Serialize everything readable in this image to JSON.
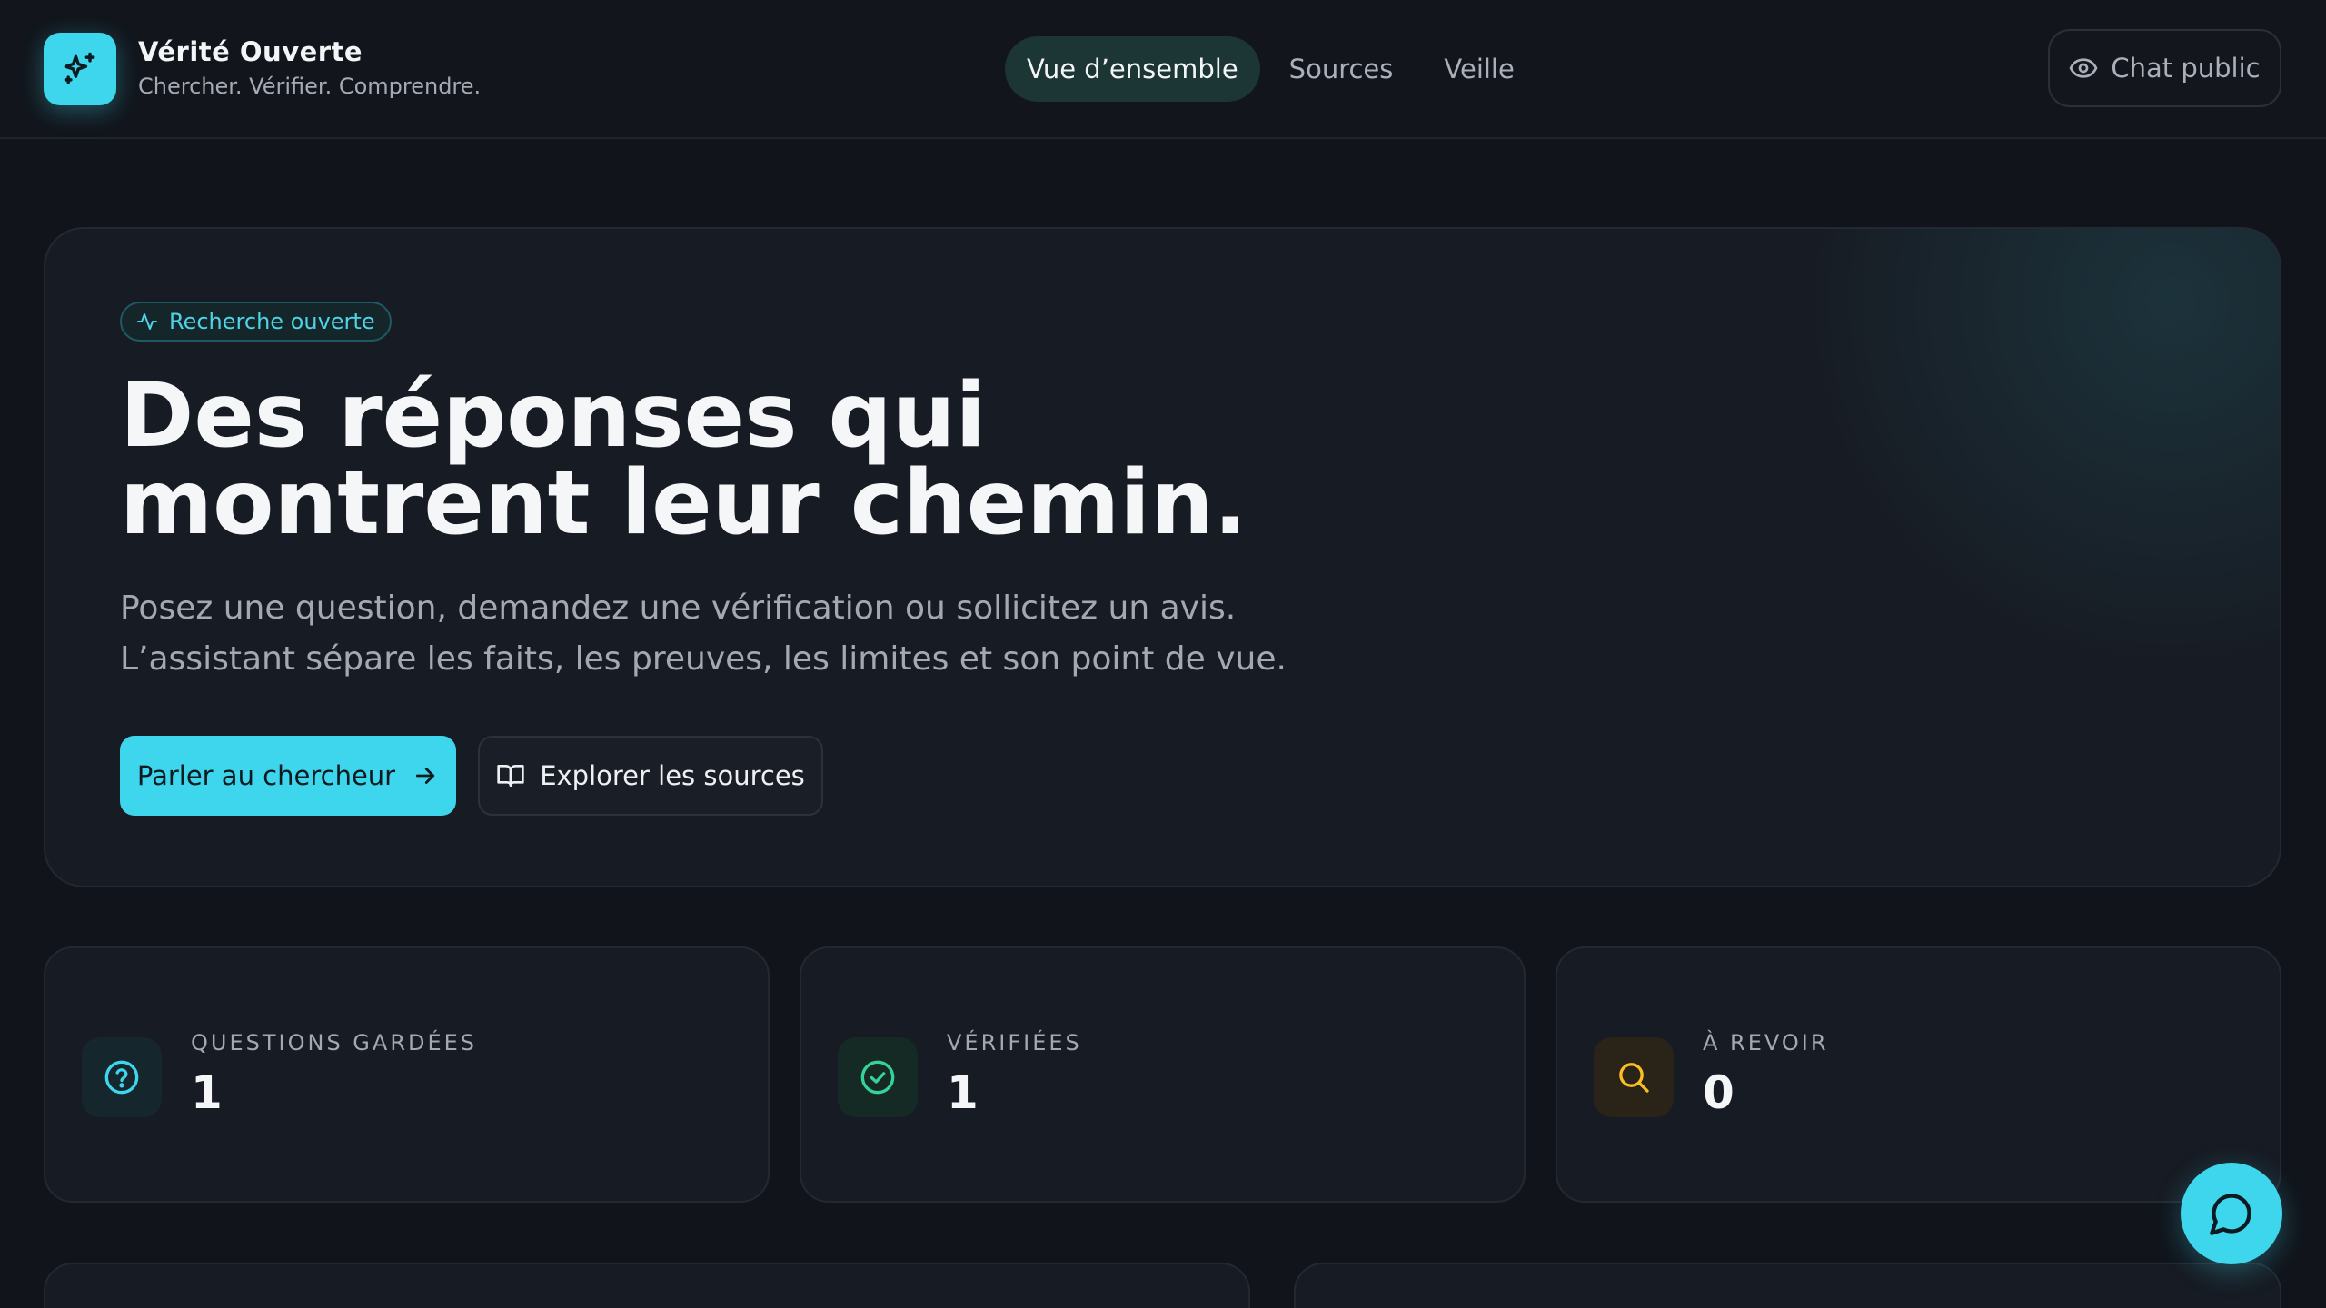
{
  "brand": {
    "title": "Vérité Ouverte",
    "tagline": "Chercher. Vérifier. Comprendre.",
    "logo_icon": "sparkles-icon"
  },
  "nav": {
    "tabs": [
      {
        "label": "Vue d’ensemble",
        "active": true
      },
      {
        "label": "Sources",
        "active": false
      },
      {
        "label": "Veille",
        "active": false
      }
    ]
  },
  "chat_public": {
    "label": "Chat public",
    "icon": "eye-icon"
  },
  "hero": {
    "badge": "Recherche ouverte",
    "title_line1": "Des réponses qui",
    "title_line2": "montrent leur chemin.",
    "desc_line1": "Posez une question, demandez une vérification ou sollicitez un avis.",
    "desc_line2": "L’assistant sépare les faits, les preuves, les limites et son point de vue.",
    "primary_button": "Parler au chercheur",
    "secondary_button": "Explorer les sources"
  },
  "stats": [
    {
      "label": "QUESTIONS GARDÉES",
      "value": "1",
      "icon": "help-circle-icon",
      "color": "#3dd6ec"
    },
    {
      "label": "VÉRIFIÉES",
      "value": "1",
      "icon": "check-circle-icon",
      "color": "#34d399"
    },
    {
      "label": "À REVOIR",
      "value": "0",
      "icon": "search-icon",
      "color": "#fbbf24"
    }
  ],
  "colors": {
    "accent": "#3dd6ec",
    "background": "#11141b",
    "card": "#171b23"
  }
}
